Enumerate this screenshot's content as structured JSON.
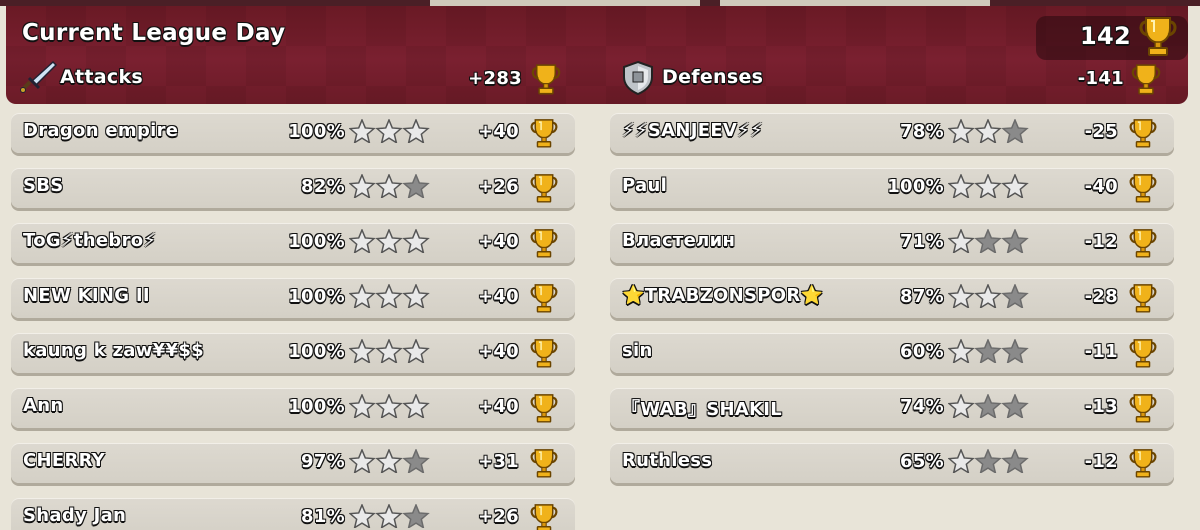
{
  "header": {
    "title": "Current League Day",
    "total_trophies": "142"
  },
  "attacks": {
    "label": "Attacks",
    "total": "+283",
    "rows": [
      {
        "name": "Dragon empire",
        "percent": "100%",
        "stars": 3,
        "trophies": "+40"
      },
      {
        "name": "SBS",
        "percent": "82%",
        "stars": 2,
        "trophies": "+26"
      },
      {
        "name": "ToG⚡thebro⚡",
        "percent": "100%",
        "stars": 3,
        "trophies": "+40"
      },
      {
        "name": "NEW KING II",
        "percent": "100%",
        "stars": 3,
        "trophies": "+40"
      },
      {
        "name": "kaung k zaw¥¥$$",
        "percent": "100%",
        "stars": 3,
        "trophies": "+40"
      },
      {
        "name": "Ann",
        "percent": "100%",
        "stars": 3,
        "trophies": "+40"
      },
      {
        "name": "CHERRY",
        "percent": "97%",
        "stars": 2,
        "trophies": "+31"
      },
      {
        "name": "Shady Jan",
        "percent": "81%",
        "stars": 2,
        "trophies": "+26"
      }
    ]
  },
  "defenses": {
    "label": "Defenses",
    "total": "-141",
    "rows": [
      {
        "name": "⚡⚡SANJEEV⚡⚡",
        "percent": "78%",
        "stars": 2,
        "trophies": "-25"
      },
      {
        "name": "Paul",
        "percent": "100%",
        "stars": 3,
        "trophies": "-40"
      },
      {
        "name": "Властелин",
        "percent": "71%",
        "stars": 1,
        "trophies": "-12"
      },
      {
        "name": "⭐TRABZONSPOR⭐",
        "percent": "87%",
        "stars": 2,
        "trophies": "-28"
      },
      {
        "name": "sin",
        "percent": "60%",
        "stars": 1,
        "trophies": "-11"
      },
      {
        "name": "『WAB』SHAKIL",
        "percent": "74%",
        "stars": 1,
        "trophies": "-13"
      },
      {
        "name": "Ruthless",
        "percent": "65%",
        "stars": 1,
        "trophies": "-12"
      }
    ]
  },
  "colors": {
    "header_bg": "#7a2030",
    "row_bg": "#d9d5cc",
    "star_filled": "#e9e9e9",
    "star_empty": "#8a8a8a",
    "trophy_gold": "#f0b21a"
  },
  "icons": {
    "attack": "sword-icon",
    "defense": "shield-icon",
    "trophy": "trophy-icon",
    "star": "star-icon"
  }
}
